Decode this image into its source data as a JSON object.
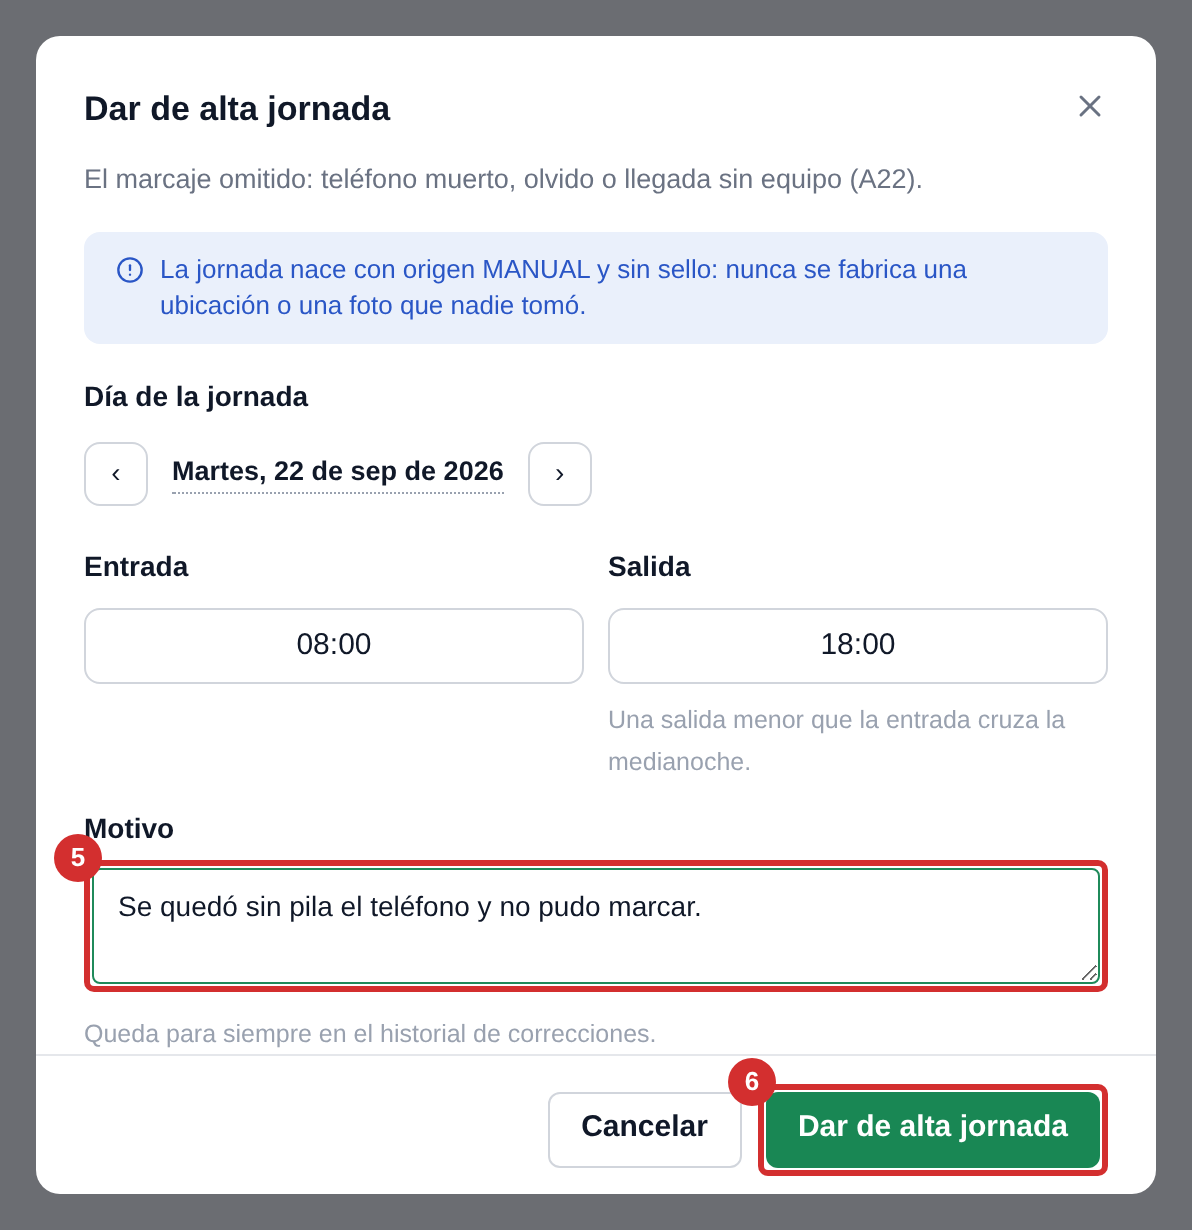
{
  "dialog": {
    "title": "Dar de alta jornada",
    "subtitle": "El marcaje omitido: teléfono muerto, olvido o llegada sin equipo (A22).",
    "notice": "La jornada nace con origen MANUAL y sin sello: nunca se fabrica una ubicación o una foto que nadie tomó.",
    "day": {
      "label": "Día de la jornada",
      "prev": "‹",
      "value": "Martes, 22 de sep de 2026",
      "next": "›"
    },
    "times": [
      {
        "label": "Entrada",
        "value": "08:00"
      },
      {
        "label": "Salida",
        "value": "18:00",
        "hint": "Una salida menor que la entrada cruza la medianoche."
      }
    ],
    "reason": {
      "label": "Motivo",
      "value": "Se quedó sin pila el teléfono y no pudo marcar.",
      "hint": "Queda para siempre en el historial de correcciones.",
      "callout": "5"
    },
    "buttons": [
      {
        "kind": "secondary",
        "label": "Cancelar"
      },
      {
        "kind": "primary",
        "label": "Dar de alta jornada",
        "callout": "6"
      }
    ]
  }
}
